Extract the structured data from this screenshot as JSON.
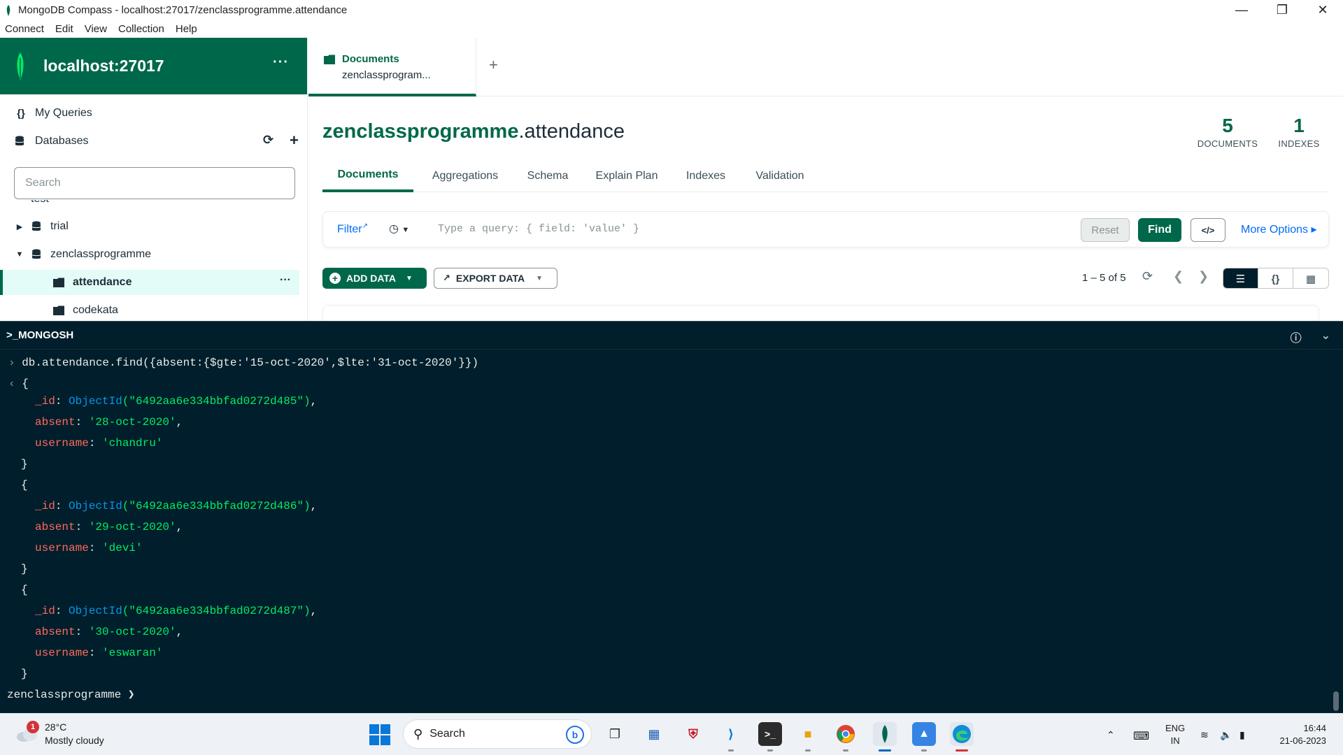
{
  "window": {
    "title": "MongoDB Compass - localhost:27017/zenclassprogramme.attendance"
  },
  "menu": [
    "Connect",
    "Edit",
    "View",
    "Collection",
    "Help"
  ],
  "sidebar": {
    "host": "localhost:27017",
    "more": "···",
    "my_queries": "My Queries",
    "databases": "Databases",
    "search_placeholder": "Search",
    "tree": {
      "partial": "test",
      "db_trial": "trial",
      "db_zen": "zenclassprogramme",
      "coll_attendance": "attendance",
      "coll_codekata": "codekata",
      "row_more": "···"
    }
  },
  "tab": {
    "title": "Documents",
    "subtitle": "zenclassprogram...",
    "add": "+"
  },
  "namespace": {
    "db": "zenclassprogramme",
    "collection": ".attendance"
  },
  "stats": {
    "documents": {
      "value": "5",
      "label": "DOCUMENTS"
    },
    "indexes": {
      "value": "1",
      "label": "INDEXES"
    }
  },
  "subtabs": [
    "Documents",
    "Aggregations",
    "Schema",
    "Explain Plan",
    "Indexes",
    "Validation"
  ],
  "filter": {
    "label": "Filter",
    "placeholder": "Type a query: { field: 'value' }",
    "reset": "Reset",
    "find": "Find",
    "code": "</>",
    "more_options": "More Options ▸"
  },
  "toolbar": {
    "add_data": "ADD DATA",
    "export_data": "EXPORT DATA",
    "pager": "1 – 5 of 5"
  },
  "shell": {
    "title": ">_MONGOSH",
    "command": "db.attendance.find({absent:{$gte:'15-oct-2020',$lte:'31-oct-2020'}})",
    "docs": [
      {
        "id": "6492aa6e334bbfad0272d485",
        "absent": "'28-oct-2020'",
        "username": "'chandru'"
      },
      {
        "id": "6492aa6e334bbfad0272d486",
        "absent": "'29-oct-2020'",
        "username": "'devi'"
      },
      {
        "id": "6492aa6e334bbfad0272d487",
        "absent": "'30-oct-2020'",
        "username": "'eswaran'"
      }
    ],
    "keys": {
      "id": "_id",
      "absent": "absent",
      "username": "username",
      "objectid": "ObjectId"
    },
    "prompt": "zenclassprogramme"
  },
  "taskbar": {
    "weather_temp": "28°C",
    "weather_desc": "Mostly cloudy",
    "weather_badge": "1",
    "search": "Search",
    "lang_1": "ENG",
    "lang_2": "IN",
    "time": "16:44",
    "date": "21-06-2023"
  },
  "colors": {
    "brand_green": "#00684a",
    "shell_bg": "#001e2b",
    "link_blue": "#016bf8"
  }
}
